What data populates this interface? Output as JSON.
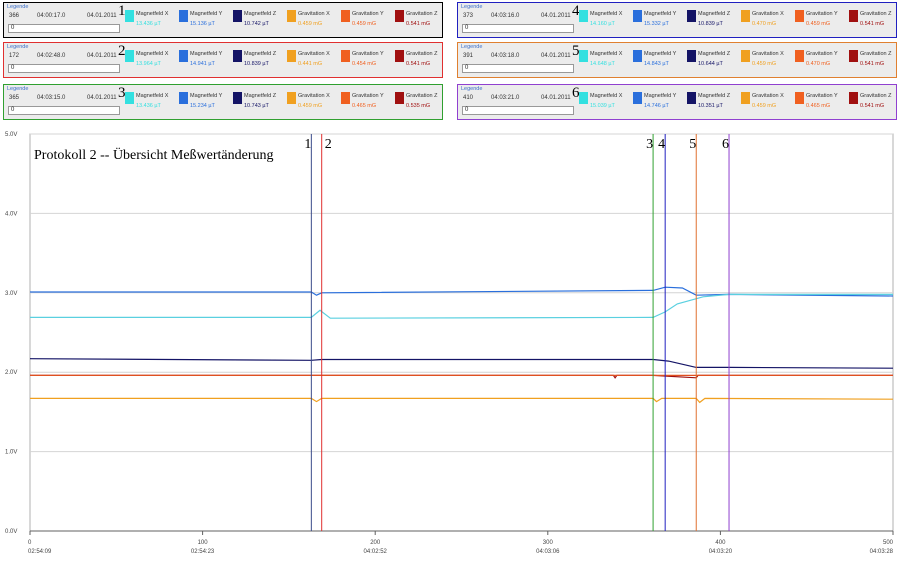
{
  "legends": [
    {
      "title": "Legende",
      "id": "366",
      "time": "04:00:17.0",
      "date": "04.01.2011",
      "input": "0",
      "marker": "1",
      "border": "#000000"
    },
    {
      "title": "Legende",
      "id": "172",
      "time": "04:02:48.0",
      "date": "04.01.2011",
      "input": "0",
      "marker": "2",
      "border": "#e03030"
    },
    {
      "title": "Legende",
      "id": "365",
      "time": "04:03:15.0",
      "date": "04.01.2011",
      "input": "0",
      "marker": "3",
      "border": "#30a030"
    },
    {
      "title": "Legende",
      "id": "373",
      "time": "04:03:16.0",
      "date": "04.01.2011",
      "input": "0",
      "marker": "4",
      "border": "#2020c0"
    },
    {
      "title": "Legende",
      "id": "391",
      "time": "04:03:18.0",
      "date": "04.01.2011",
      "input": "0",
      "marker": "5",
      "border": "#e08030"
    },
    {
      "title": "Legende",
      "id": "410",
      "time": "04:03:21.0",
      "date": "04.01.2011",
      "input": "0",
      "marker": "6",
      "border": "#9040d0"
    }
  ],
  "channels": [
    {
      "name": "Magnetfeld X",
      "color": "#33e0e0"
    },
    {
      "name": "Magnetfeld Y",
      "color": "#2a6fdc"
    },
    {
      "name": "Magnetfeld Z",
      "color": "#141466"
    },
    {
      "name": "Gravitation X",
      "color": "#f0a020"
    },
    {
      "name": "Gravitation Y",
      "color": "#f06020"
    },
    {
      "name": "Gravitation Z",
      "color": "#a01010"
    }
  ],
  "legend_values": [
    [
      "13.436 µT",
      "15.136 µT",
      "10.742 µT",
      "0.459 mG",
      "0.459 mG",
      "0.541 mG"
    ],
    [
      "13.964 µT",
      "14.941 µT",
      "10.839 µT",
      "0.441 mG",
      "0.454 mG",
      "0.541 mG"
    ],
    [
      "13.436 µT",
      "15.234 µT",
      "10.743 µT",
      "0.459 mG",
      "0.465 mG",
      "0.535 mG"
    ],
    [
      "14.160 µT",
      "15.332 µT",
      "10.839 µT",
      "0.470 mG",
      "0.459 mG",
      "0.541 mG"
    ],
    [
      "14.648 µT",
      "14.843 µT",
      "10.644 µT",
      "0.459 mG",
      "0.470 mG",
      "0.541 mG"
    ],
    [
      "15.039 µT",
      "14.746 µT",
      "10.351 µT",
      "0.459 mG",
      "0.465 mG",
      "0.541 mG"
    ]
  ],
  "chart_data": {
    "type": "line",
    "title": "Protokoll 2 -- Übersicht Meßwertänderung",
    "y_ticks": [
      "0.0V",
      "1.0V",
      "2.0V",
      "3.0V",
      "4.0V",
      "5.0V"
    ],
    "ylim": [
      0,
      5
    ],
    "xlim": [
      0,
      500
    ],
    "x_ticks": [
      {
        "value": 0,
        "label": "0",
        "time": "02:54:09"
      },
      {
        "value": 100,
        "label": "100",
        "time": "02:54:23"
      },
      {
        "value": 200,
        "label": "200",
        "time": "04:02:52"
      },
      {
        "value": 300,
        "label": "300",
        "time": "04:03:06"
      },
      {
        "value": 400,
        "label": "400",
        "time": "04:03:20"
      },
      {
        "value": 500,
        "label": "500",
        "time": "04:03:28"
      }
    ],
    "markers": [
      {
        "label": "1",
        "x": 163,
        "color": "#3a4a8a"
      },
      {
        "label": "2",
        "x": 169,
        "color": "#e03030"
      },
      {
        "label": "3",
        "x": 361,
        "color": "#30a030"
      },
      {
        "label": "4",
        "x": 368,
        "color": "#2020c0"
      },
      {
        "label": "5",
        "x": 386,
        "color": "#e07030"
      },
      {
        "label": "6",
        "x": 405,
        "color": "#9040d0"
      }
    ],
    "series": [
      {
        "name": "Magnetfeld Y",
        "color": "#2a6fdc",
        "points": [
          [
            0,
            3.01
          ],
          [
            163,
            3.01
          ],
          [
            166,
            2.97
          ],
          [
            169,
            3.0
          ],
          [
            361,
            3.03
          ],
          [
            368,
            3.07
          ],
          [
            378,
            3.06
          ],
          [
            386,
            2.97
          ],
          [
            405,
            2.98
          ],
          [
            500,
            2.96
          ]
        ]
      },
      {
        "name": "Magnetfeld X",
        "color": "#5ad0e0",
        "points": [
          [
            0,
            2.69
          ],
          [
            163,
            2.69
          ],
          [
            168,
            2.78
          ],
          [
            174,
            2.68
          ],
          [
            361,
            2.69
          ],
          [
            368,
            2.76
          ],
          [
            375,
            2.86
          ],
          [
            390,
            2.95
          ],
          [
            405,
            2.98
          ],
          [
            500,
            2.98
          ]
        ]
      },
      {
        "name": "Magnetfeld Z",
        "color": "#141466",
        "points": [
          [
            0,
            2.17
          ],
          [
            163,
            2.15
          ],
          [
            169,
            2.16
          ],
          [
            361,
            2.16
          ],
          [
            370,
            2.14
          ],
          [
            386,
            2.06
          ],
          [
            405,
            2.06
          ],
          [
            500,
            2.05
          ]
        ]
      },
      {
        "name": "Gravitation Z",
        "color": "#a01010",
        "points": [
          [
            0,
            1.96
          ],
          [
            163,
            1.96
          ],
          [
            169,
            1.96
          ],
          [
            338,
            1.96
          ],
          [
            339,
            1.93
          ],
          [
            340,
            1.96
          ],
          [
            361,
            1.96
          ],
          [
            386,
            1.93
          ],
          [
            387,
            1.96
          ],
          [
            500,
            1.96
          ]
        ]
      },
      {
        "name": "Gravitation Y",
        "color": "#e05020",
        "points": [
          [
            0,
            1.96
          ],
          [
            500,
            1.96
          ]
        ]
      },
      {
        "name": "Gravitation X",
        "color": "#f0a020",
        "points": [
          [
            0,
            1.67
          ],
          [
            163,
            1.67
          ],
          [
            166,
            1.63
          ],
          [
            169,
            1.67
          ],
          [
            361,
            1.67
          ],
          [
            363,
            1.63
          ],
          [
            366,
            1.67
          ],
          [
            386,
            1.67
          ],
          [
            388,
            1.62
          ],
          [
            391,
            1.67
          ],
          [
            500,
            1.66
          ]
        ]
      }
    ],
    "grid": true,
    "legend_placement": "top"
  }
}
